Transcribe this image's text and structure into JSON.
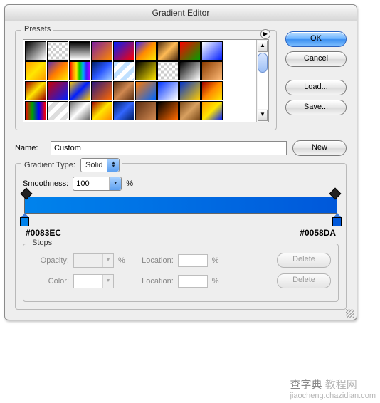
{
  "title": "Gradient Editor",
  "buttons": {
    "ok": "OK",
    "cancel": "Cancel",
    "load": "Load...",
    "save": "Save...",
    "new": "New",
    "delete": "Delete"
  },
  "labels": {
    "presets": "Presets",
    "name": "Name:",
    "gradient_type": "Gradient Type:",
    "smoothness": "Smoothness:",
    "percent": "%",
    "stops": "Stops",
    "opacity": "Opacity:",
    "color": "Color:",
    "location": "Location:"
  },
  "name_value": "Custom",
  "gradient_type_value": "Solid",
  "smoothness_value": "100",
  "gradient_left_hex": "#0083EC",
  "gradient_right_hex": "#0058DA",
  "preset_swatches": [
    "linear-gradient(135deg,#000,#fff)",
    "repeating-conic-gradient(#fff 0 25%,#ccc 0 50%) 0/8px 8px",
    "linear-gradient(#000,#fff)",
    "linear-gradient(135deg,#7d1fa0,#ff8a00)",
    "linear-gradient(135deg,#001eff,#ff0000)",
    "linear-gradient(135deg,#3b1fff,#ff8a00,#ffe600)",
    "linear-gradient(135deg,#4f2e12,#ffbb55,#4f2e12)",
    "linear-gradient(135deg,#ff0000,#00a000)",
    "linear-gradient(135deg,#ffffff,#001eff)",
    "linear-gradient(135deg,#ff9a00,#ffe600,#ff9a00)",
    "linear-gradient(135deg,#5b2db0,#ff7a00,#ffe600)",
    "linear-gradient(90deg,#ff0000,#ff8a00,#ffe600,#00c400,#00b2ff,#3b1fff,#a000ff)",
    "linear-gradient(135deg,#001e64,#2a57ff,#9ecbff)",
    "repeating-linear-gradient(135deg,#bfe0ff 0 6px,#ffffff 6px 12px)",
    "linear-gradient(135deg,#000,#ffe600)",
    "repeating-conic-gradient(#fff 0 25%,#ccc 0 50%) 0/8px 8px",
    "linear-gradient(135deg,#000,#fff)",
    "linear-gradient(135deg,#8a3b00,#ffbb77)",
    "linear-gradient(135deg,#a00000,#ffe600,#a00000)",
    "linear-gradient(135deg,#cc0000,#001eff)",
    "linear-gradient(135deg,#ffcc00,#001eff,#ffcc00)",
    "linear-gradient(135deg,#2a1680,#ff6a00)",
    "linear-gradient(135deg,#5b2e12,#d08850,#5b2e12)",
    "linear-gradient(135deg,#ff7a00,#0066ff)",
    "linear-gradient(135deg,#0033ff,#ffffff)",
    "linear-gradient(135deg,#0033cc,#ffcc00)",
    "linear-gradient(135deg,#a00000,#ff8a00,#ffe600)",
    "linear-gradient(90deg,#ff0000,#00a000,#0000ff,#ff0000)",
    "repeating-linear-gradient(135deg,#ffffff 0 6px,#dddddd 6px 12px)",
    "linear-gradient(135deg,#6a6a6a,#ffffff,#6a6a6a)",
    "linear-gradient(135deg,#a00000,#ffe600,#ff8a00)",
    "linear-gradient(135deg,#001e64,#3366ff,#001e64)",
    "linear-gradient(135deg,#5b2e12,#d08850)",
    "linear-gradient(135deg,#000,#ff6a00)",
    "linear-gradient(135deg,#7b4a1a,#d8a060,#7b4a1a)",
    "linear-gradient(135deg,#ff9a00,#ffe600,#001eff)"
  ],
  "watermark": {
    "a": "查字典",
    "b": "教程网",
    "c": "jiaocheng.chazidian.com"
  }
}
